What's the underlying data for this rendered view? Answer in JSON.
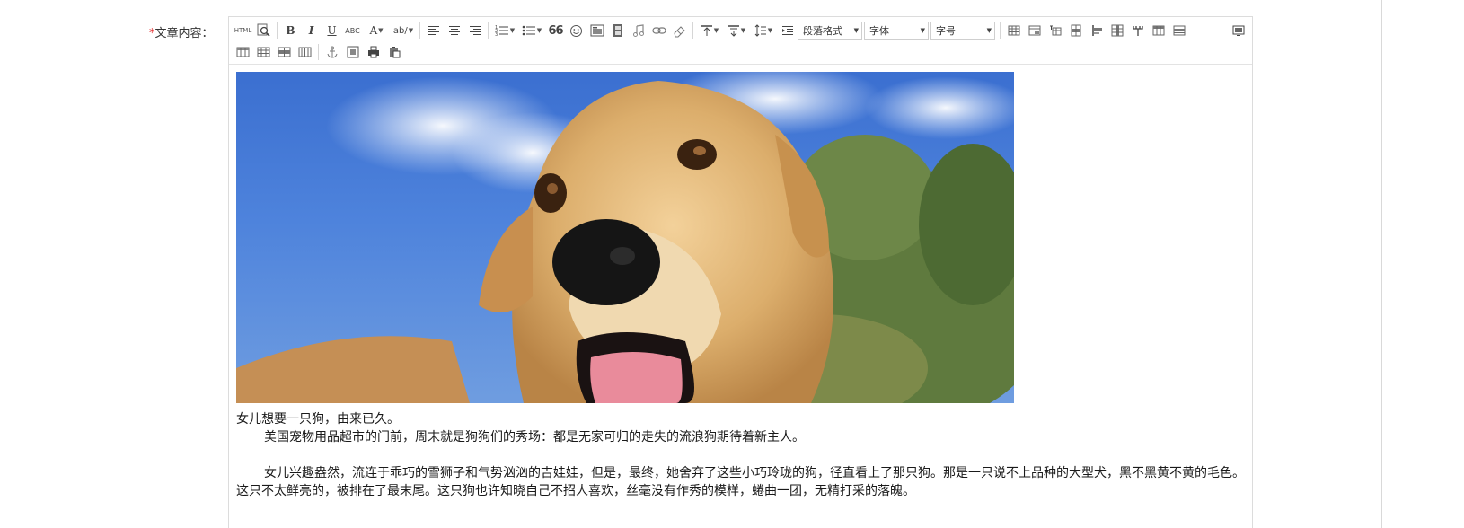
{
  "form": {
    "required_mark": "*",
    "label": "文章内容："
  },
  "toolbar": {
    "row1": [
      {
        "name": "html-source-button",
        "glyph": "HTML"
      },
      {
        "name": "preview-button",
        "icon": "magnifier-icon"
      },
      {
        "name": "bold-button",
        "glyph": "B"
      },
      {
        "name": "italic-button",
        "glyph": "I"
      },
      {
        "name": "underline-button",
        "glyph": "U"
      },
      {
        "name": "strikethrough-button",
        "glyph": "ABC"
      },
      {
        "name": "font-color-button",
        "glyph": "A"
      },
      {
        "name": "back-color-button",
        "glyph": "ab"
      },
      {
        "name": "align-left-button",
        "icon": "align-left-icon"
      },
      {
        "name": "align-center-button",
        "icon": "align-center-icon"
      },
      {
        "name": "align-right-button",
        "icon": "align-right-icon"
      },
      {
        "name": "ordered-list-button",
        "icon": "ordered-list-icon"
      },
      {
        "name": "unordered-list-button",
        "icon": "unordered-list-icon"
      },
      {
        "name": "blockquote-button",
        "glyph": "66"
      },
      {
        "name": "emoji-button",
        "icon": "smiley-icon"
      },
      {
        "name": "insert-image-button",
        "icon": "image-icon"
      },
      {
        "name": "insert-video-button",
        "icon": "film-icon"
      },
      {
        "name": "insert-music-button",
        "icon": "music-icon"
      },
      {
        "name": "insert-link-button",
        "icon": "link-icon"
      },
      {
        "name": "eraser-button",
        "icon": "eraser-icon"
      },
      {
        "name": "row-spacing-top-button",
        "icon": "row-spacing-top-icon"
      },
      {
        "name": "row-spacing-bottom-button",
        "icon": "row-spacing-bottom-icon"
      },
      {
        "name": "line-height-button",
        "icon": "line-height-icon"
      },
      {
        "name": "indent-button",
        "icon": "indent-icon"
      }
    ],
    "paragraph_format": "段落格式",
    "font_family": "字体",
    "font_size": "字号",
    "row1_table_icons": [
      "table-icon",
      "table-props-icon",
      "insert-caption-icon",
      "insert-row-icon",
      "insert-paragraph-icon",
      "merge-cells-icon",
      "split-icon",
      "insert-col-icon",
      "delete-col-icon"
    ],
    "fullscreen_icon": "fullscreen-icon",
    "row2_icons": [
      "table-row-icon",
      "table-grid-icon",
      "table-header-icon",
      "table-cols-icon",
      "anchor-icon",
      "code-icon",
      "print-icon",
      "paste-icon"
    ]
  },
  "article": {
    "image_alt": "golden retriever photo",
    "lines": [
      "女儿想要一只狗，由来已久。",
      "美国宠物用品超市的门前，周末就是狗狗们的秀场：都是无家可归的走失的流浪狗期待着新主人。",
      "女儿兴趣盎然，流连于乖巧的雪狮子和气势汹汹的吉娃娃，但是，最终，她舍弃了这些小巧玲珑的狗，径直看上了那只狗。那是一只说不上品种的大型犬，黑不黑黄不黄的毛色。这只不太鲜亮的，被排在了最末尾。这只狗也许知晓自己不招人喜欢，丝毫没有作秀的模样，蜷曲一团，无精打采的落魄。"
    ]
  },
  "colors": {
    "required": "#e02020",
    "sky": "#3b6fd0",
    "fur": "#d9a865"
  }
}
